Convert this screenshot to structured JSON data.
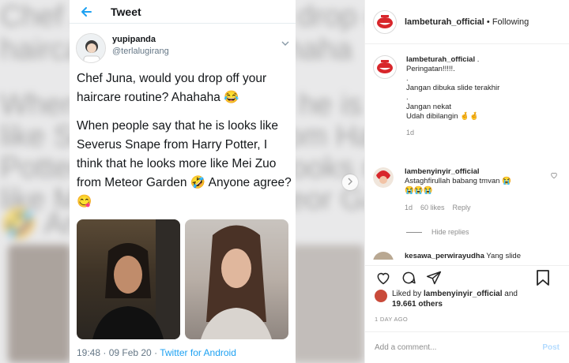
{
  "background_text": {
    "line1": "Chef Juna, would you drop off your",
    "line2": "haircare routine? Ahahaha",
    "line3": "When people say that he is looks",
    "line4": "like Severus Snape from Harry",
    "line5": "Potter, I think that he looks more",
    "line6": "like Mei Zuo from Meteor Garden",
    "line7": "🤣 Anyone agree?"
  },
  "tweet": {
    "header_title": "Tweet",
    "display_name": "yupipanda",
    "handle": "@terlalugirang",
    "paragraph1": "Chef Juna, would you drop off your haircare routine? Ahahaha 😂",
    "paragraph2": "When people say that he is looks like Severus Snape from Harry Potter, I think that he looks more like Mei Zuo from Meteor Garden 🤣 Anyone agree? 😋",
    "time": "19:48 · 09 Feb 20 · ",
    "source": "Twitter for Android"
  },
  "instagram": {
    "account": "lambeturah_official",
    "separator": " • ",
    "follow_status": "Following",
    "caption": {
      "username": "lambeturah_official",
      "first_text": " .",
      "lines": [
        "Peringatan!!!!!.",
        ".",
        "Jangan dibuka slide terakhir",
        ".",
        "Jangan nekat",
        "Udah dibilangin 🤞🤞"
      ],
      "time": "1d"
    },
    "comment": {
      "username": "lambenyinyir_official",
      "text": "Astaghfirullah babang tmvan 😭",
      "emoji_line": "😭😭😭",
      "time": "1d",
      "likes": "60 likes",
      "reply": "Reply",
      "hide_replies": "Hide replies"
    },
    "comment2": {
      "username": "kesawa_perwirayudha",
      "text": " Yang slide"
    },
    "likes": {
      "prefix": "Liked by ",
      "user": "lambenyinyir_official",
      "connector": " and",
      "others": "19.661 others"
    },
    "date": "1 DAY AGO",
    "add_comment_placeholder": "Add a comment...",
    "post_label": "Post",
    "colors": {
      "link_blue": "#1da1f2",
      "post_disabled": "#b3dbff",
      "avatar_red": "#d8262b"
    }
  }
}
